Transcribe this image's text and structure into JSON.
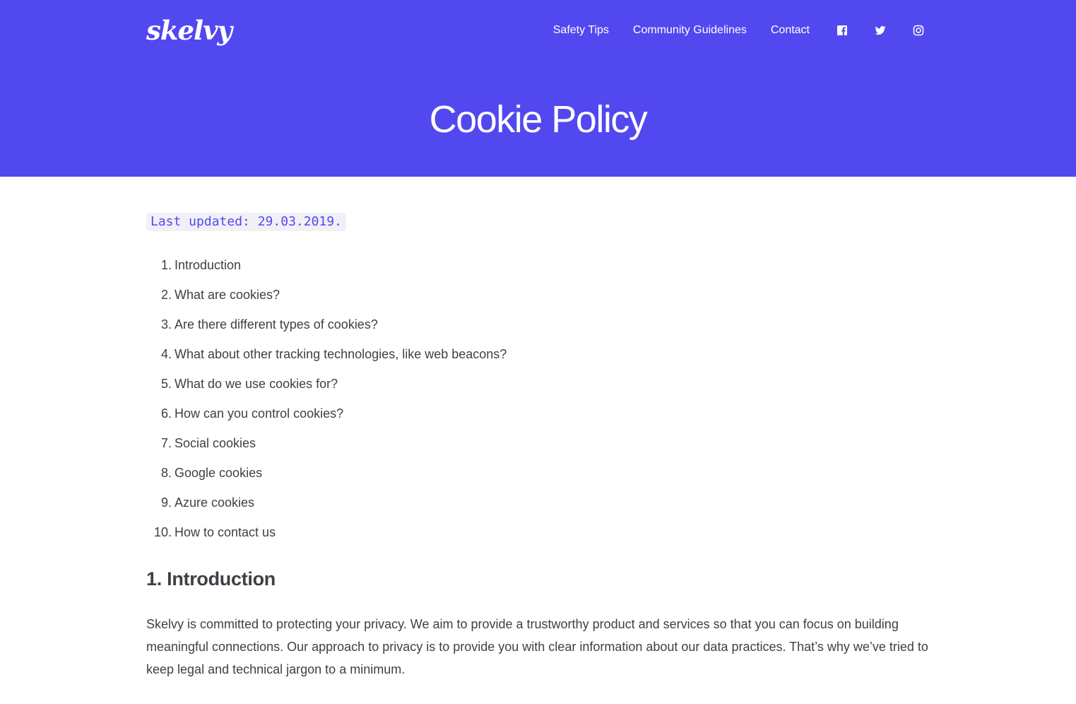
{
  "brand": {
    "logo_text": "skelvy",
    "accent_color": "#5248f0"
  },
  "nav": {
    "links": [
      {
        "label": "Safety Tips"
      },
      {
        "label": "Community Guidelines"
      },
      {
        "label": "Contact"
      }
    ],
    "social": [
      "facebook-icon",
      "twitter-icon",
      "instagram-icon"
    ]
  },
  "page": {
    "title": "Cookie Policy"
  },
  "content": {
    "last_updated": "Last updated: 29.03.2019.",
    "toc": [
      {
        "num": "1.",
        "label": "Introduction"
      },
      {
        "num": "2.",
        "label": "What are cookies?"
      },
      {
        "num": "3.",
        "label": "Are there different types of cookies?"
      },
      {
        "num": "4.",
        "label": "What about other tracking technologies, like web beacons?"
      },
      {
        "num": "5.",
        "label": "What do we use cookies for?"
      },
      {
        "num": "6.",
        "label": "How can you control cookies?"
      },
      {
        "num": "7.",
        "label": "Social cookies"
      },
      {
        "num": "8.",
        "label": "Google cookies"
      },
      {
        "num": "9.",
        "label": "Azure cookies"
      },
      {
        "num": "10.",
        "label": "How to contact us"
      }
    ],
    "section1": {
      "heading": "1. Introduction",
      "paragraph": "Skelvy is committed to protecting your privacy. We aim to provide a trustworthy product and services so that you can focus on building meaningful connections. Our approach to privacy is to provide you with clear information about our data practices. That’s why we’ve tried to keep legal and technical jargon to a minimum."
    }
  }
}
